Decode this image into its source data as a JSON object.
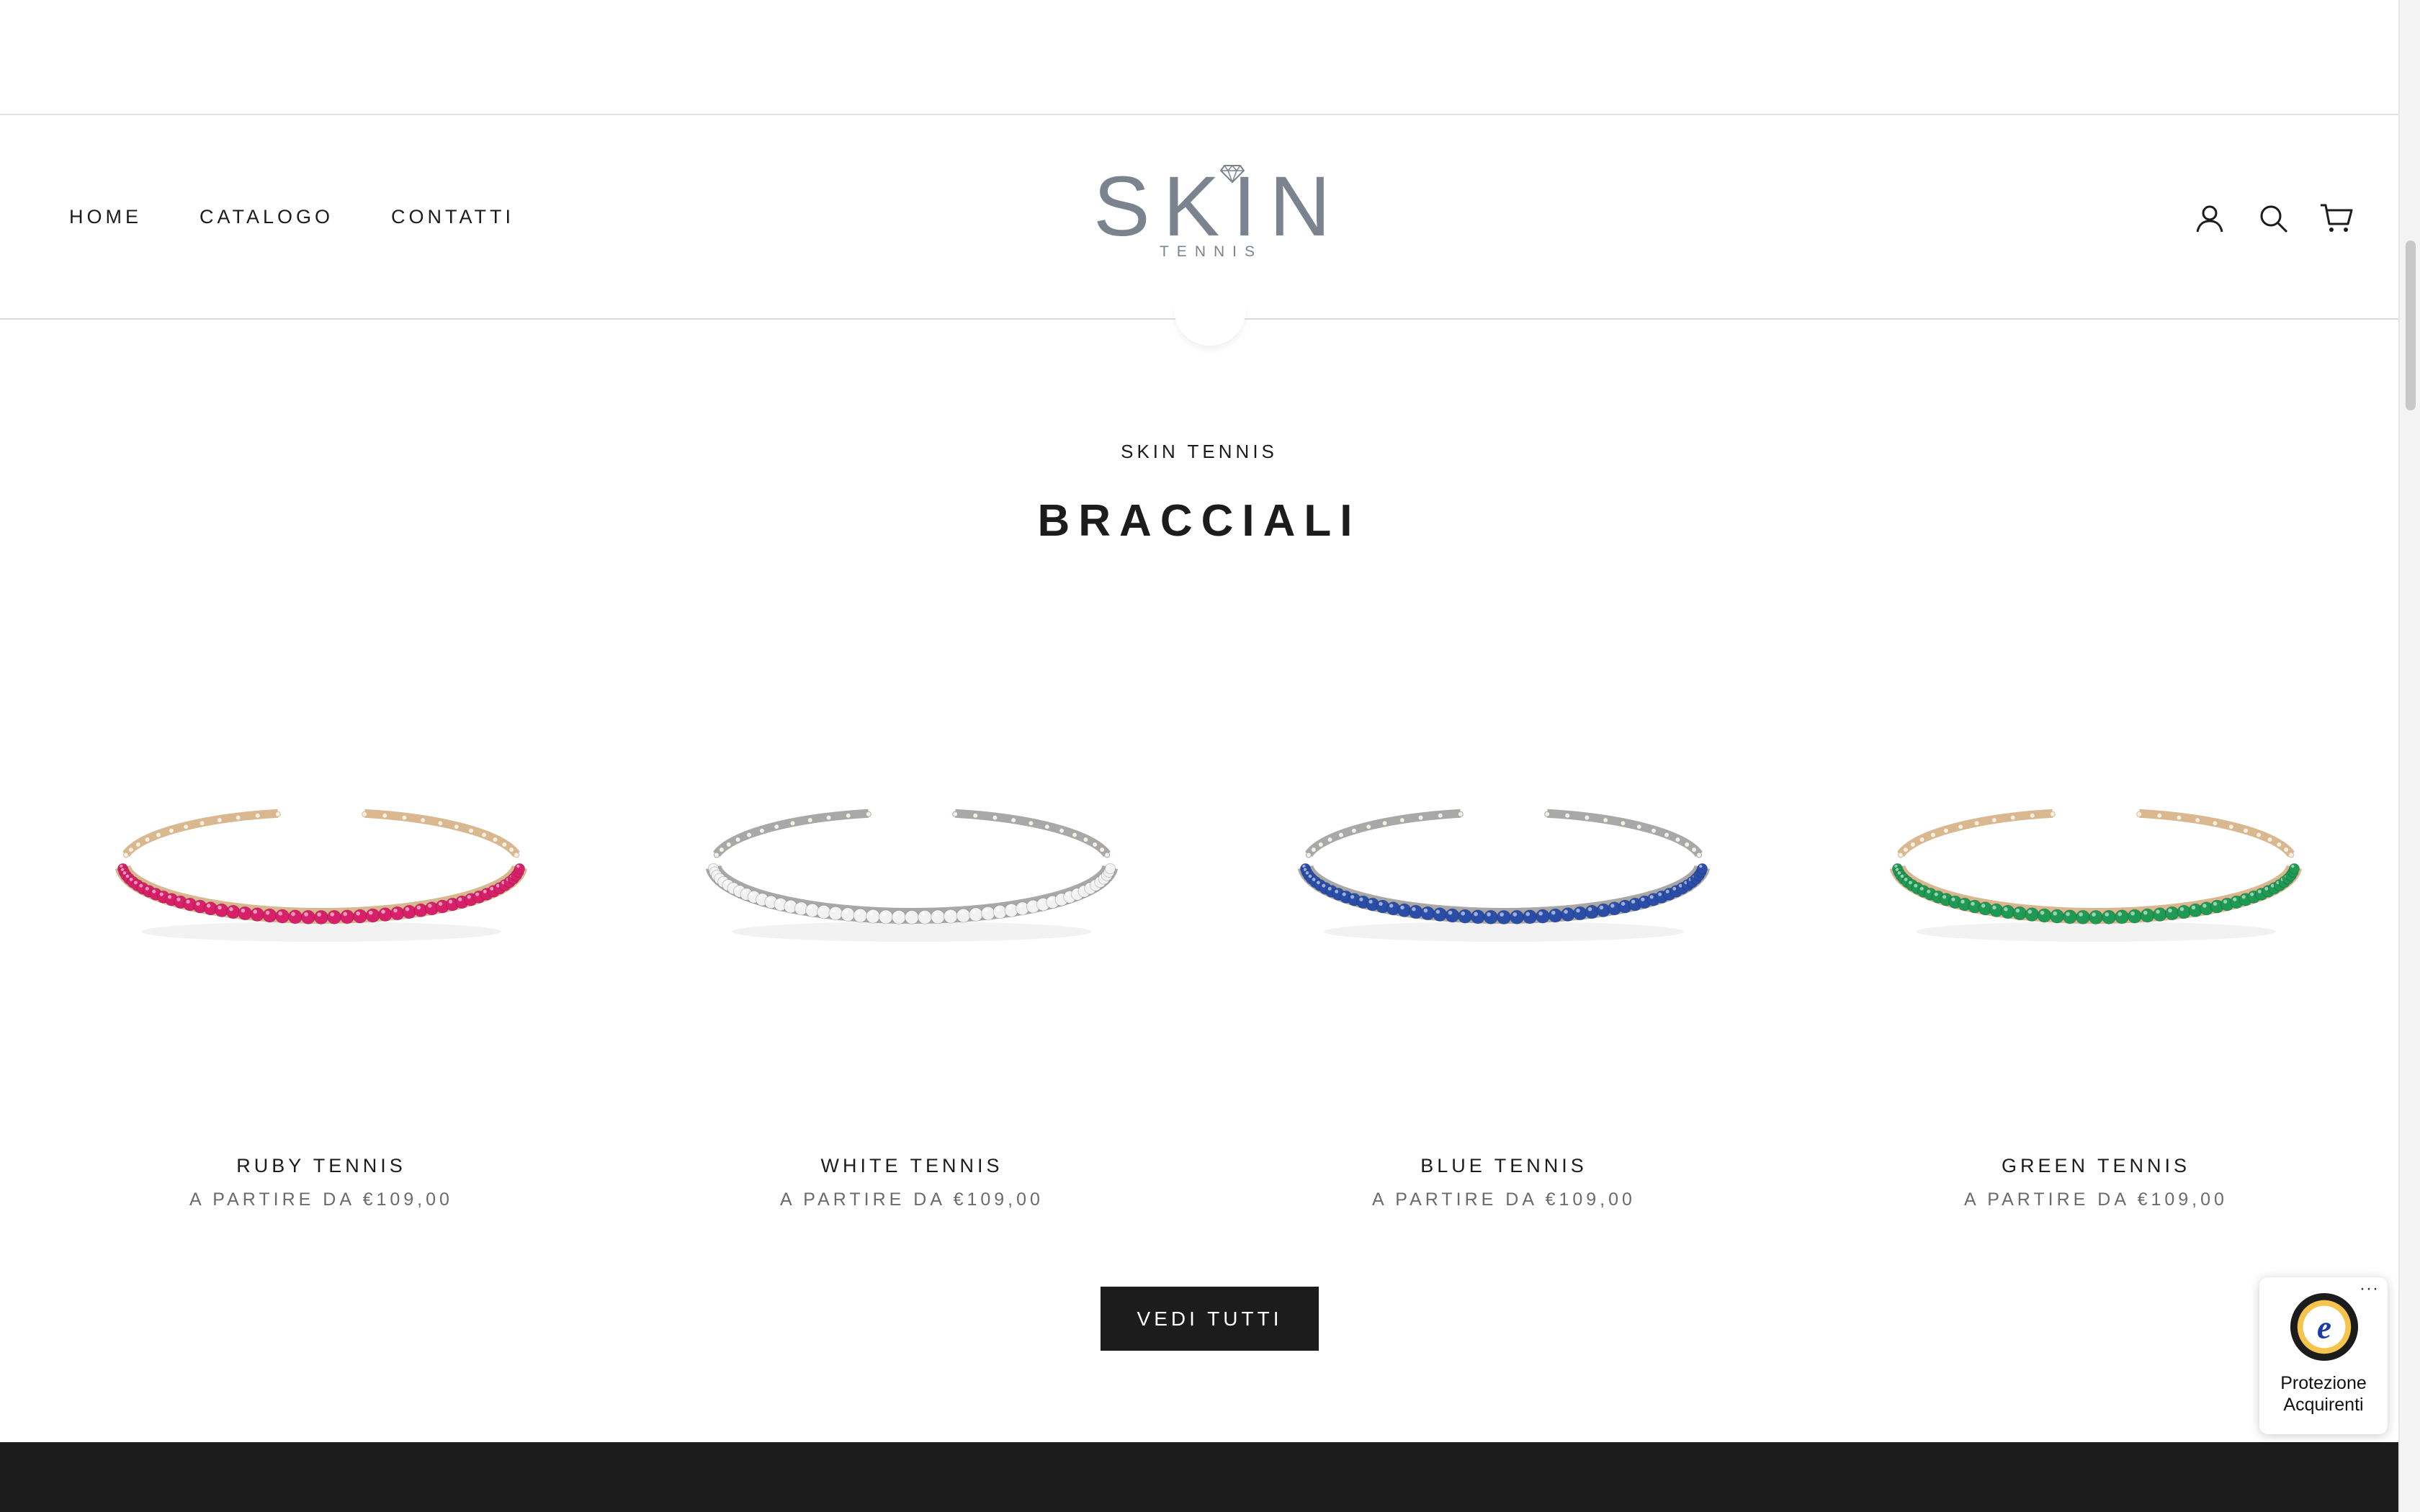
{
  "header": {
    "nav": [
      {
        "label": "HOME"
      },
      {
        "label": "CATALOGO"
      },
      {
        "label": "CONTATTI"
      }
    ],
    "logo": {
      "main": "SKIN",
      "sub": "TENNIS"
    },
    "icons": [
      "account-icon",
      "search-icon",
      "cart-icon"
    ]
  },
  "section": {
    "eyebrow": "SKIN TENNIS",
    "title": "BRACCIALI"
  },
  "products": [
    {
      "name": "RUBY TENNIS",
      "price": "A PARTIRE DA €109,00",
      "stone_color": "#d8206a",
      "metal_color": "#d9b88f"
    },
    {
      "name": "WHITE TENNIS",
      "price": "A PARTIRE DA €109,00",
      "stone_color": "#f2f2f2",
      "metal_color": "#a8a8a8"
    },
    {
      "name": "BLUE TENNIS",
      "price": "A PARTIRE DA €109,00",
      "stone_color": "#2a4ea8",
      "metal_color": "#a8a8a8"
    },
    {
      "name": "GREEN TENNIS",
      "price": "A PARTIRE DA €109,00",
      "stone_color": "#1e9a55",
      "metal_color": "#d9b88f"
    }
  ],
  "cta": {
    "label": "VEDI TUTTI"
  },
  "trust_badge": {
    "label_line1": "Protezione",
    "label_line2": "Acquirenti",
    "menu": "···"
  },
  "colors": {
    "accent": "#1c1c1c",
    "logo": "#7b848e",
    "muted_text": "#6b6b6b"
  }
}
